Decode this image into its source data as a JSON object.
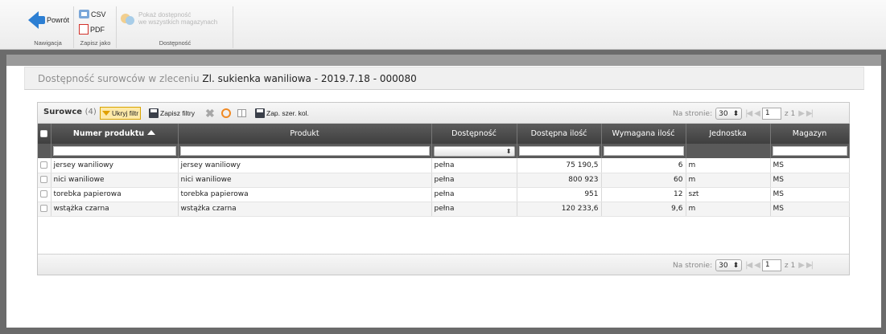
{
  "ribbon": {
    "groups": {
      "navigation": "Nawigacja",
      "save_as": "Zapisz jako",
      "availability": "Dostępność"
    },
    "back_label": "Powrót",
    "csv_label": "CSV",
    "pdf_label": "PDF",
    "show_availability_line1": "Pokaż dostępność",
    "show_availability_line2": "we wszystkich magazynach"
  },
  "title": {
    "lead": "Dostępność surowców w zleceniu",
    "order": "Zl. sukienka waniliowa - 2019.7.18 - 000080"
  },
  "grid": {
    "caption": "Surowce",
    "count": "(4)",
    "toolbar": {
      "hide_filter": "Ukryj filtr",
      "save_filters": "Zapisz filtry",
      "save_widths": "Zap. szer. kol."
    },
    "pager": {
      "per_page_label": "Na stronie:",
      "per_page_value": "30",
      "page": "1",
      "of_pages": "z 1"
    },
    "columns": [
      "Numer produktu",
      "Produkt",
      "Dostępność",
      "Dostępna ilość",
      "Wymagana ilość",
      "Jednostka",
      "Magazyn"
    ],
    "rows": [
      [
        "jersey waniliowy",
        "jersey waniliowy",
        "pełna",
        "75 190,5",
        "6",
        "m",
        "MS"
      ],
      [
        "nici waniliowe",
        "nici waniliowe",
        "pełna",
        "800 923",
        "60",
        "m",
        "MS"
      ],
      [
        "torebka papierowa",
        "torebka papierowa",
        "pełna",
        "951",
        "12",
        "szt",
        "MS"
      ],
      [
        "wstążka czarna",
        "wstążka czarna",
        "pełna",
        "120 233,6",
        "9,6",
        "m",
        "MS"
      ]
    ]
  }
}
